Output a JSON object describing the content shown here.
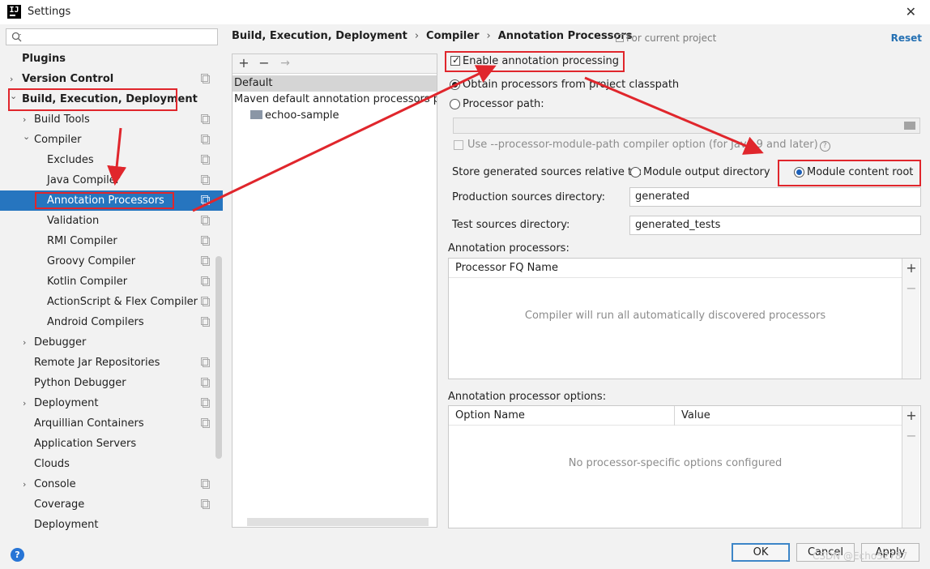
{
  "window": {
    "icon_text": "IJ",
    "title": "Settings",
    "close_glyph": "✕"
  },
  "sidebar": {
    "search_placeholder": "",
    "items": [
      {
        "label": "Plugins",
        "level": 0,
        "bold": true,
        "chevron": "",
        "project_icon": false
      },
      {
        "label": "Version Control",
        "level": 0,
        "bold": true,
        "chevron": "›",
        "project_icon": true
      },
      {
        "label": "Build, Execution, Deployment",
        "level": 0,
        "bold": true,
        "chevron": "⌄",
        "project_icon": false
      },
      {
        "label": "Build Tools",
        "level": 1,
        "bold": false,
        "chevron": "›",
        "project_icon": true
      },
      {
        "label": "Compiler",
        "level": 1,
        "bold": false,
        "chevron": "⌄",
        "project_icon": true
      },
      {
        "label": "Excludes",
        "level": 2,
        "bold": false,
        "chevron": "",
        "project_icon": true
      },
      {
        "label": "Java Compiler",
        "level": 2,
        "bold": false,
        "chevron": "",
        "project_icon": true
      },
      {
        "label": "Annotation Processors",
        "level": 2,
        "bold": false,
        "chevron": "",
        "project_icon": true,
        "selected": true
      },
      {
        "label": "Validation",
        "level": 2,
        "bold": false,
        "chevron": "",
        "project_icon": true
      },
      {
        "label": "RMI Compiler",
        "level": 2,
        "bold": false,
        "chevron": "",
        "project_icon": true
      },
      {
        "label": "Groovy Compiler",
        "level": 2,
        "bold": false,
        "chevron": "",
        "project_icon": true
      },
      {
        "label": "Kotlin Compiler",
        "level": 2,
        "bold": false,
        "chevron": "",
        "project_icon": true
      },
      {
        "label": "ActionScript & Flex Compiler",
        "level": 2,
        "bold": false,
        "chevron": "",
        "project_icon": true
      },
      {
        "label": "Android Compilers",
        "level": 2,
        "bold": false,
        "chevron": "",
        "project_icon": true
      },
      {
        "label": "Debugger",
        "level": 1,
        "bold": false,
        "chevron": "›",
        "project_icon": false
      },
      {
        "label": "Remote Jar Repositories",
        "level": 1,
        "bold": false,
        "chevron": "",
        "project_icon": true
      },
      {
        "label": "Python Debugger",
        "level": 1,
        "bold": false,
        "chevron": "",
        "project_icon": true
      },
      {
        "label": "Deployment",
        "level": 1,
        "bold": false,
        "chevron": "›",
        "project_icon": true
      },
      {
        "label": "Arquillian Containers",
        "level": 1,
        "bold": false,
        "chevron": "",
        "project_icon": true
      },
      {
        "label": "Application Servers",
        "level": 1,
        "bold": false,
        "chevron": "",
        "project_icon": false
      },
      {
        "label": "Clouds",
        "level": 1,
        "bold": false,
        "chevron": "",
        "project_icon": false
      },
      {
        "label": "Console",
        "level": 1,
        "bold": false,
        "chevron": "›",
        "project_icon": true
      },
      {
        "label": "Coverage",
        "level": 1,
        "bold": false,
        "chevron": "",
        "project_icon": true
      },
      {
        "label": "Deployment",
        "level": 1,
        "bold": false,
        "chevron": "",
        "project_icon": false
      }
    ]
  },
  "breadcrumb": {
    "parts": [
      "Build, Execution, Deployment",
      "Compiler",
      "Annotation Processors"
    ],
    "separator": "›"
  },
  "for_current_project": "For current project",
  "reset": "Reset",
  "profiles": {
    "toolbar": {
      "add": "+",
      "remove": "−",
      "move": "→"
    },
    "rows": [
      "Default",
      "Maven default annotation processors profile",
      "echoo-sample"
    ]
  },
  "form": {
    "enable_processing": {
      "label": "Enable annotation processing",
      "checked": true
    },
    "obtain_from_classpath": "Obtain processors from project classpath",
    "processor_path": "Processor path:",
    "processor_path_value": "",
    "module_path_option": "Use --processor-module-path compiler option (for Java 9 and later)",
    "store_generated_label": "Store generated sources relative to:",
    "module_output_dir": "Module output directory",
    "module_content_root": "Module content root",
    "production_sources_label": "Production sources directory:",
    "production_sources_value": "generated",
    "test_sources_label": "Test sources directory:",
    "test_sources_value": "generated_tests",
    "annotation_processors_label": "Annotation processors:",
    "processor_fq_header": "Processor FQ Name",
    "processors_empty": "Compiler will run all automatically discovered processors",
    "processor_options_label": "Annotation processor options:",
    "option_name_header": "Option Name",
    "value_header": "Value",
    "options_empty": "No processor-specific options configured",
    "table_add": "+",
    "table_remove": "−"
  },
  "buttons": {
    "help": "?",
    "ok": "OK",
    "cancel": "Cancel",
    "apply": "Apply"
  },
  "watermark": "CSDN @Echo52787",
  "colors": {
    "selection": "#2675bf",
    "annotation_red": "#e0262c",
    "link": "#2470b3"
  }
}
